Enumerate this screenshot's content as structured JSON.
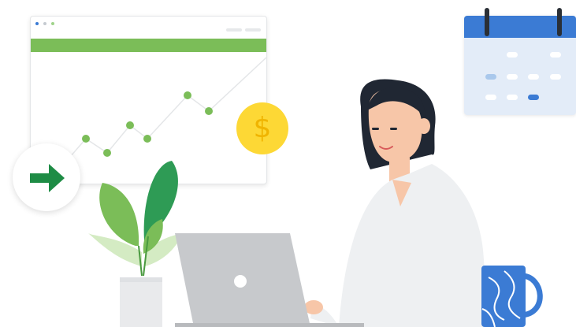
{
  "coin": {
    "symbol": "$"
  },
  "calendar": {
    "highlight_color": "#a9c8ec",
    "selected_color": "#3b7bd4"
  },
  "colors": {
    "chart_green": "#7bbd58",
    "arrow_green": "#1e8c45",
    "coin_yellow": "#fdd835",
    "calendar_blue": "#3b7bd4"
  },
  "icons": {
    "arrow": "arrow-right-icon",
    "coin": "dollar-coin-icon",
    "calendar": "calendar-icon"
  }
}
